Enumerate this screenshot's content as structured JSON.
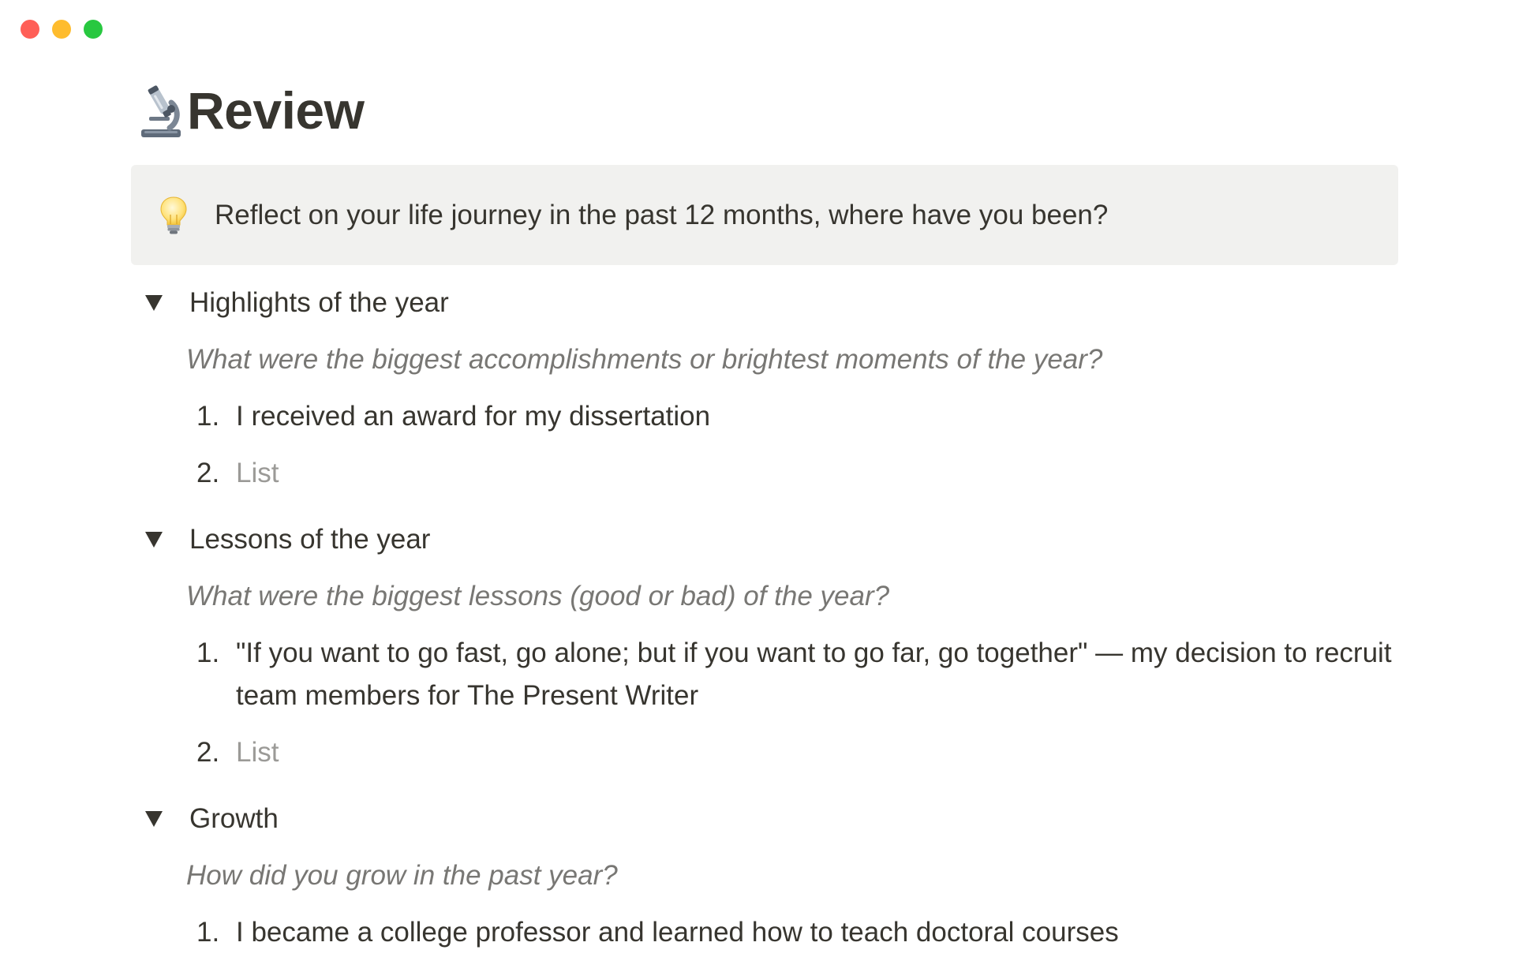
{
  "window": {
    "controls": {
      "close_color": "#ff5f57",
      "minimize_color": "#febc2e",
      "zoom_color": "#28c840"
    }
  },
  "page": {
    "icon": "microscope-icon",
    "title": "Review"
  },
  "callout": {
    "icon": "light-bulb-icon",
    "text": "Reflect on your life journey in the past 12 months, where have you been?"
  },
  "sections": [
    {
      "title": "Highlights of the year",
      "prompt": "What were the biggest accomplishments or brightest moments of the year?",
      "items": [
        {
          "num": "1.",
          "text": "I received an award for my dissertation"
        },
        {
          "num": "2.",
          "text": "List"
        }
      ]
    },
    {
      "title": "Lessons of the year",
      "prompt": "What were the biggest lessons (good or bad) of the year?",
      "items": [
        {
          "num": "1.",
          "text": "\"If you want to go fast, go alone; but if you want to go far, go together\" — my decision to recruit team members for The Present Writer"
        },
        {
          "num": "2.",
          "text": "List"
        }
      ]
    },
    {
      "title": "Growth",
      "prompt": "How did you grow in the past year?",
      "items": [
        {
          "num": "1.",
          "text": "I became a college professor and learned how to teach doctoral courses"
        }
      ]
    }
  ]
}
